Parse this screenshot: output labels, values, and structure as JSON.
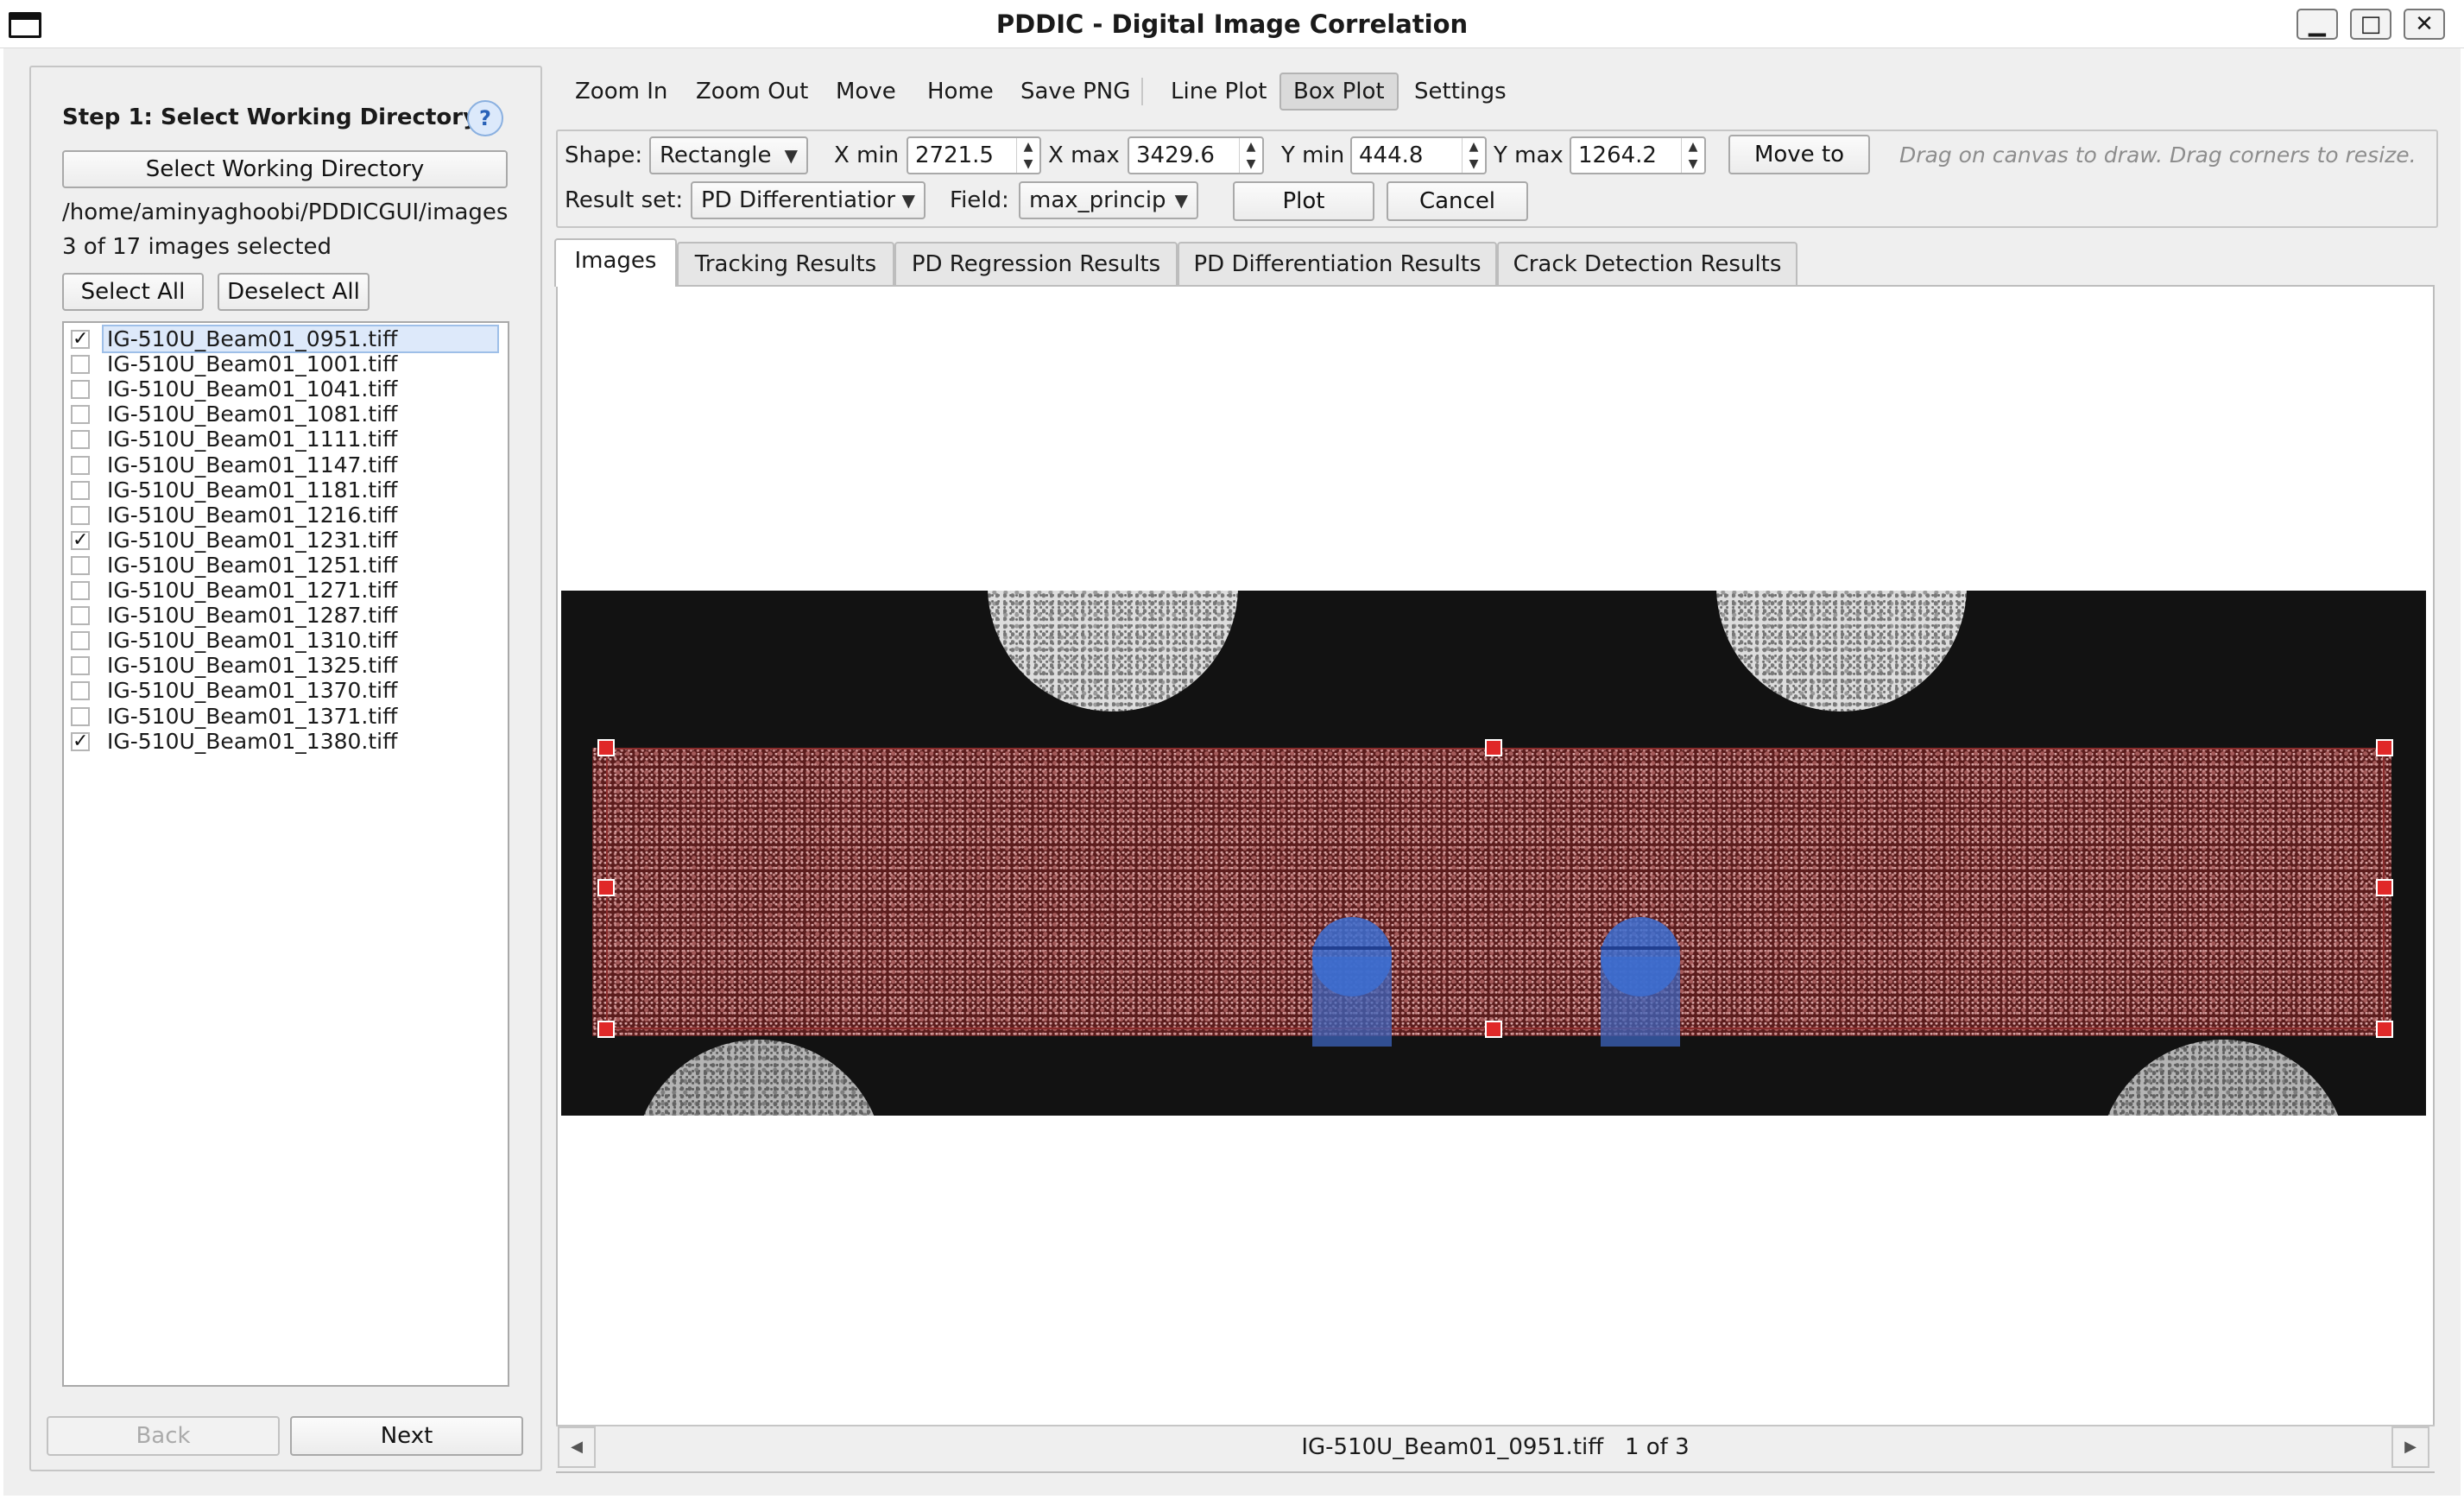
{
  "window": {
    "title": "PDDIC - Digital Image Correlation",
    "controls": {
      "minimize": "▁",
      "maximize": "□",
      "close": "✕"
    }
  },
  "left_panel": {
    "step_title": "Step 1: Select Working Directory",
    "help_label": "?",
    "select_dir_label": "Select Working Directory",
    "dir_path": "/home/aminyaghoobi/PDDICGUI/images",
    "selection_count": "3 of 17 images selected",
    "select_all_label": "Select All",
    "deselect_all_label": "Deselect All",
    "files": [
      {
        "name": "IG-510U_Beam01_0951.tiff",
        "checked": true
      },
      {
        "name": "IG-510U_Beam01_1001.tiff",
        "checked": false
      },
      {
        "name": "IG-510U_Beam01_1041.tiff",
        "checked": false
      },
      {
        "name": "IG-510U_Beam01_1081.tiff",
        "checked": false
      },
      {
        "name": "IG-510U_Beam01_1111.tiff",
        "checked": false
      },
      {
        "name": "IG-510U_Beam01_1147.tiff",
        "checked": false
      },
      {
        "name": "IG-510U_Beam01_1181.tiff",
        "checked": false
      },
      {
        "name": "IG-510U_Beam01_1216.tiff",
        "checked": false
      },
      {
        "name": "IG-510U_Beam01_1231.tiff",
        "checked": true
      },
      {
        "name": "IG-510U_Beam01_1251.tiff",
        "checked": false
      },
      {
        "name": "IG-510U_Beam01_1271.tiff",
        "checked": false
      },
      {
        "name": "IG-510U_Beam01_1287.tiff",
        "checked": false
      },
      {
        "name": "IG-510U_Beam01_1310.tiff",
        "checked": false
      },
      {
        "name": "IG-510U_Beam01_1325.tiff",
        "checked": false
      },
      {
        "name": "IG-510U_Beam01_1370.tiff",
        "checked": false
      },
      {
        "name": "IG-510U_Beam01_1371.tiff",
        "checked": false
      },
      {
        "name": "IG-510U_Beam01_1380.tiff",
        "checked": true
      }
    ],
    "back_label": "Back",
    "next_label": "Next"
  },
  "toolbar": {
    "zoom_in": "Zoom In",
    "zoom_out": "Zoom Out",
    "move": "Move",
    "home": "Home",
    "save_png": "Save PNG",
    "line_plot": "Line Plot",
    "box_plot": "Box Plot",
    "settings": "Settings"
  },
  "controls": {
    "shape_label": "Shape:",
    "shape_value": "Rectangle",
    "xmin_label": "X min",
    "xmin_value": "2721.5",
    "xmax_label": "X max",
    "xmax_value": "3429.6",
    "ymin_label": "Y min",
    "ymin_value": "444.8",
    "ymax_label": "Y max",
    "ymax_value": "1264.2",
    "move_to_label": "Move to",
    "hint": "Drag on canvas to draw.  Drag corners to resize.",
    "result_set_label": "Result set:",
    "result_set_value": "PD Differentiatior",
    "field_label": "Field:",
    "field_value": "max_princip",
    "plot_label": "Plot",
    "cancel_label": "Cancel"
  },
  "tabs": [
    {
      "label": "Images",
      "active": true
    },
    {
      "label": "Tracking Results",
      "active": false
    },
    {
      "label": "PD Regression Results",
      "active": false
    },
    {
      "label": "PD Differentiation Results",
      "active": false
    },
    {
      "label": "Crack Detection Results",
      "active": false
    }
  ],
  "status": {
    "filename": "IG-510U_Beam01_0951.tiff",
    "position": "1 of 3",
    "prev_icon": "◀",
    "next_icon": "▶"
  },
  "colors": {
    "roi_handle": "#e02828",
    "roi_fill": "#5b1c1c",
    "support_marker": "#3c6ed2"
  }
}
